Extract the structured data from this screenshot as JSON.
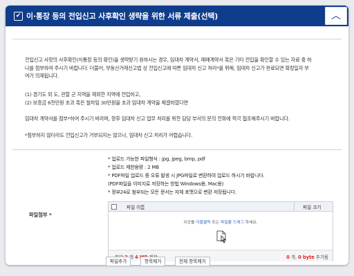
{
  "header": {
    "check_mark": "✔",
    "title": "이·통장 등의 전입신고 사후확인 생략을 위한 서류 제출(선택)",
    "collapse_glyph": "︿"
  },
  "body": {
    "p1_lines": [
      "전입신고 사항의 사후확인(이통장 등의 확인)을 생략받기 원하시는 경우, 임대차 계약서, 매매계약서 혹은 기타 전입을 확인할 수 있는 자료 중 하",
      "나를 첨부하여 주시기 바랍니다. 더불어, 부동산거래신고법 상 전입신고에 따른 임대차 신고 처리*를 위해, 임대차 신고가 완료되면 확정일자 부",
      "여가 의제됩니다."
    ],
    "p2_lines": [
      "(1) 경기도 외 도, 관할 군 지역을 제외한 지역에 전입하고,",
      "(2) 보증금 6천만원 초과 혹은 월차임 30만원을 초과 임대차 계약을 체결하였다면"
    ],
    "p3": "임대차 계약서를 첨부*하여 주시기 바라며, 향후 임대차 신고 업무 처리를 위한 담당 부서의 문의 전화에 적극 협조해주시기 바랍니다.",
    "p4": "*첨부하지 않더라도 전입신고가 거부되지는 않으나, 임대차 신고 처리가 어렵습니다."
  },
  "upload": {
    "label": "파일첨부 *",
    "rules": [
      "* 업로드 가능한 파일형식 : jpg, jpeg, bmp, pdf",
      "* 업로드 제한용량 : 2 MB",
      "* PDF파일 업로드 중 오류 발생 시 JPG파일로 변환하여 업로드 하시기 바랍니다.",
      "  (PDF파일을 이미지로 저장하는 방법 Windows용, Mac용)",
      "* 정부24로 첨부되는 모든 문서는 자체 포맷으로 변환 저장됩니다."
    ],
    "col_name": "파일 이름",
    "col_size": "파일 크기",
    "drop_pre": "이곳을 ",
    "drop_link1": "더블클릭",
    "drop_mid": " 또는 ",
    "drop_link2": "파일을 드래그",
    "drop_post": " 하세요.",
    "footer_pre": "최대 ",
    "max_count": "2",
    "footer_mid": " 개 ",
    "max_size": "4 MB",
    "footer_post": " 제한",
    "added_count": "0",
    "added_mid": " 개, ",
    "added_size": "0 byte",
    "added_post": " 추가됨",
    "buttons": {
      "add": "파일추가",
      "remove": "항목제거",
      "remove_all": "전체 항목제거"
    }
  },
  "colors": {
    "header_bg": "#0f3d8c",
    "link": "#2a63c4",
    "count_red": "#dd2222"
  }
}
